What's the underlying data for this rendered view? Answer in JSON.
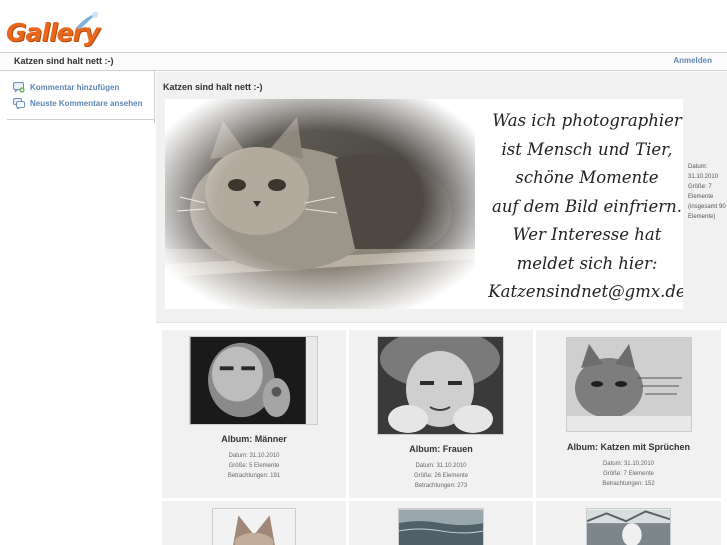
{
  "logo": {
    "text": "Gallery"
  },
  "header": {
    "title": "Katzen sind halt nett :-)",
    "login_label": "Anmelden"
  },
  "sidebar": {
    "items": [
      {
        "label": "Kommentar hinzufügen",
        "icon": "add-comment-icon"
      },
      {
        "label": "Neuste Kommentare ansehen",
        "icon": "view-comments-icon"
      }
    ]
  },
  "album": {
    "title": "Katzen sind halt nett :-)",
    "banner_lines": [
      "Was ich photographier",
      "ist Mensch und Tier,",
      "schöne Momente",
      "auf dem Bild einfriern.",
      "Wer Interesse hat",
      "meldet sich hier:",
      "Katzensindnet@gmx.de"
    ],
    "meta": {
      "date": "Datum: 31.10.2010",
      "size": "Größe: 7 Elemente",
      "total": "(insgesamt 90 Elemente)"
    }
  },
  "grid": [
    {
      "title": "Album: Männer",
      "date": "Datum: 31.10.2010",
      "size": "Größe: 5 Elemente",
      "views": "Betrachtungen: 191"
    },
    {
      "title": "Album: Frauen",
      "date": "Datum: 31.10.2010",
      "size": "Größe: 26 Elemente",
      "views": "Betrachtungen: 273"
    },
    {
      "title": "Album: Katzen mit Sprüchen",
      "date": "Datum: 31.10.2010",
      "size": "Größe: 7 Elemente",
      "views": "Betrachtungen: 152"
    },
    {
      "title": ""
    },
    {
      "title": ""
    },
    {
      "title": ""
    }
  ],
  "colors": {
    "logo": "#e8671b",
    "link": "#5f86b5",
    "panel": "#f1f1f1"
  }
}
